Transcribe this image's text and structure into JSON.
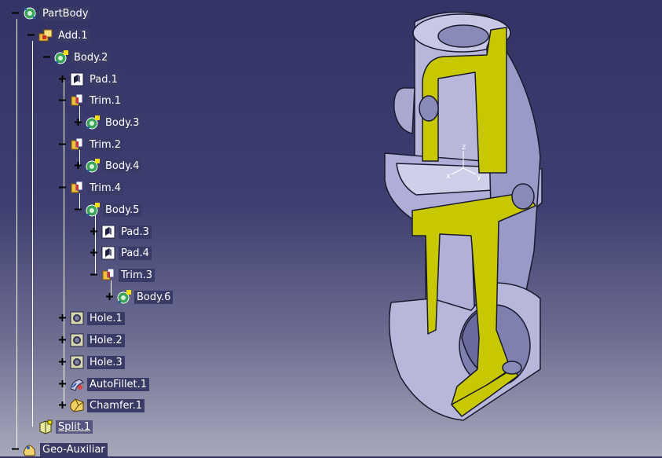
{
  "tree": {
    "nodes": [
      {
        "id": "partbody",
        "label": "PartBody",
        "icon": "partbody-icon",
        "toggle": "minus"
      },
      {
        "id": "add-1",
        "label": "Add.1",
        "icon": "boolean-add-icon",
        "toggle": "minus"
      },
      {
        "id": "body-2",
        "label": "Body.2",
        "icon": "body-icon",
        "toggle": "minus"
      },
      {
        "id": "pad-1",
        "label": "Pad.1",
        "icon": "pad-icon",
        "toggle": "plus"
      },
      {
        "id": "trim-1",
        "label": "Trim.1",
        "icon": "boolean-trim-icon",
        "toggle": "minus"
      },
      {
        "id": "body-3",
        "label": "Body.3",
        "icon": "body-icon",
        "toggle": "plus"
      },
      {
        "id": "trim-2",
        "label": "Trim.2",
        "icon": "boolean-trim-icon",
        "toggle": "minus"
      },
      {
        "id": "body-4",
        "label": "Body.4",
        "icon": "body-icon",
        "toggle": "plus"
      },
      {
        "id": "trim-4",
        "label": "Trim.4",
        "icon": "boolean-trim-icon",
        "toggle": "minus"
      },
      {
        "id": "body-5",
        "label": "Body.5",
        "icon": "body-icon",
        "toggle": "minus"
      },
      {
        "id": "pad-3",
        "label": "Pad.3",
        "icon": "pad-icon",
        "toggle": "plus"
      },
      {
        "id": "pad-4",
        "label": "Pad.4",
        "icon": "pad-icon",
        "toggle": "plus"
      },
      {
        "id": "trim-3",
        "label": "Trim.3",
        "icon": "boolean-trim-icon",
        "toggle": "minus"
      },
      {
        "id": "body-6",
        "label": "Body.6",
        "icon": "body-icon",
        "toggle": "plus"
      },
      {
        "id": "hole-1",
        "label": "Hole.1",
        "icon": "hole-icon",
        "toggle": "plus"
      },
      {
        "id": "hole-2",
        "label": "Hole.2",
        "icon": "hole-icon",
        "toggle": "plus"
      },
      {
        "id": "hole-3",
        "label": "Hole.3",
        "icon": "hole-icon",
        "toggle": "plus"
      },
      {
        "id": "autofillet-1",
        "label": "AutoFillet.1",
        "icon": "autofillet-icon",
        "toggle": "plus"
      },
      {
        "id": "chamfer-1",
        "label": "Chamfer.1",
        "icon": "chamfer-icon",
        "toggle": "plus"
      },
      {
        "id": "split-1",
        "label": "Split.1",
        "icon": "split-icon",
        "toggle": "none",
        "highlighted": true
      },
      {
        "id": "geo-auxiliar",
        "label": "Geo-Auxiliar",
        "icon": "geometrical-set-icon",
        "toggle": "minus"
      }
    ]
  },
  "viewport": {
    "axis_labels": {
      "x": "x",
      "y": "y",
      "z": "z"
    },
    "colors": {
      "section": "#c8c800",
      "surface": "#b7b7dc",
      "shadow": "#7777a8",
      "edge": "#1a1a2e"
    }
  }
}
